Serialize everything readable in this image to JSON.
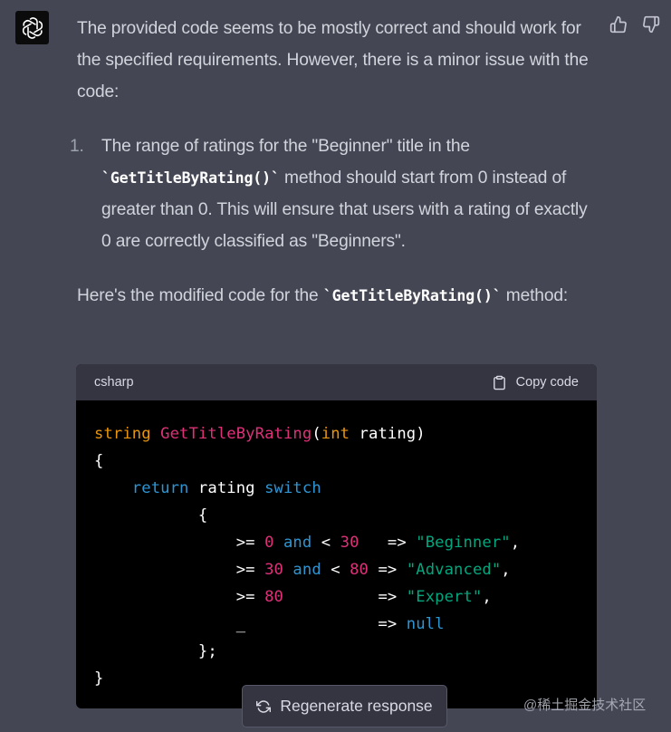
{
  "message": {
    "paragraph1": "The provided code seems to be mostly correct and should work for the specified requirements. However, there is a minor issue with the code:",
    "list": [
      {
        "number": "1.",
        "text_before": "The range of ratings for the \"Beginner\" title in the ",
        "code": "`GetTitleByRating()`",
        "text_after": " method should start from 0 instead of greater than 0. This will ensure that users with a rating of exactly 0 are correctly classified as \"Beginners\"."
      }
    ],
    "paragraph2_before": "Here's the modified code for the ",
    "paragraph2_code": "`GetTitleByRating()`",
    "paragraph2_after": " method:"
  },
  "code_block": {
    "language": "csharp",
    "copy_label": "Copy code",
    "lines": [
      [
        {
          "t": "string",
          "c": "kw-type"
        },
        {
          "t": " "
        },
        {
          "t": "GetTitleByRating",
          "c": "fn"
        },
        {
          "t": "("
        },
        {
          "t": "int",
          "c": "kw-type"
        },
        {
          "t": " rating)"
        }
      ],
      [
        {
          "t": "{"
        }
      ],
      [
        {
          "t": "    "
        },
        {
          "t": "return",
          "c": "kw"
        },
        {
          "t": " rating "
        },
        {
          "t": "switch",
          "c": "kw"
        }
      ],
      [
        {
          "t": "           {"
        }
      ],
      [
        {
          "t": "               >= "
        },
        {
          "t": "0",
          "c": "num-lit"
        },
        {
          "t": " "
        },
        {
          "t": "and",
          "c": "kw"
        },
        {
          "t": " < "
        },
        {
          "t": "30",
          "c": "num-lit"
        },
        {
          "t": "   => "
        },
        {
          "t": "\"Beginner\"",
          "c": "str"
        },
        {
          "t": ","
        }
      ],
      [
        {
          "t": "               >= "
        },
        {
          "t": "30",
          "c": "num-lit"
        },
        {
          "t": " "
        },
        {
          "t": "and",
          "c": "kw"
        },
        {
          "t": " < "
        },
        {
          "t": "80",
          "c": "num-lit"
        },
        {
          "t": " => "
        },
        {
          "t": "\"Advanced\"",
          "c": "str"
        },
        {
          "t": ","
        }
      ],
      [
        {
          "t": "               >= "
        },
        {
          "t": "80",
          "c": "num-lit"
        },
        {
          "t": "          => "
        },
        {
          "t": "\"Expert\"",
          "c": "str"
        },
        {
          "t": ","
        }
      ],
      [
        {
          "t": "               _              => "
        },
        {
          "t": "null",
          "c": "kw"
        }
      ],
      [
        {
          "t": "           };"
        }
      ],
      [
        {
          "t": "}"
        }
      ]
    ]
  },
  "actions": {
    "regenerate_label": "Regenerate response"
  },
  "watermark": "@稀土掘金技术社区",
  "icons": {
    "avatar": "openai-logo-icon",
    "thumbs_up": "thumbs-up-icon",
    "thumbs_down": "thumbs-down-icon",
    "copy": "clipboard-icon",
    "regenerate": "refresh-icon"
  },
  "colors": {
    "background": "#444654",
    "code_header": "#343541",
    "code_body": "#000000",
    "keyword": "#2e95d3",
    "type": "#e9950c",
    "function": "#df3079",
    "string": "#00a67d"
  }
}
